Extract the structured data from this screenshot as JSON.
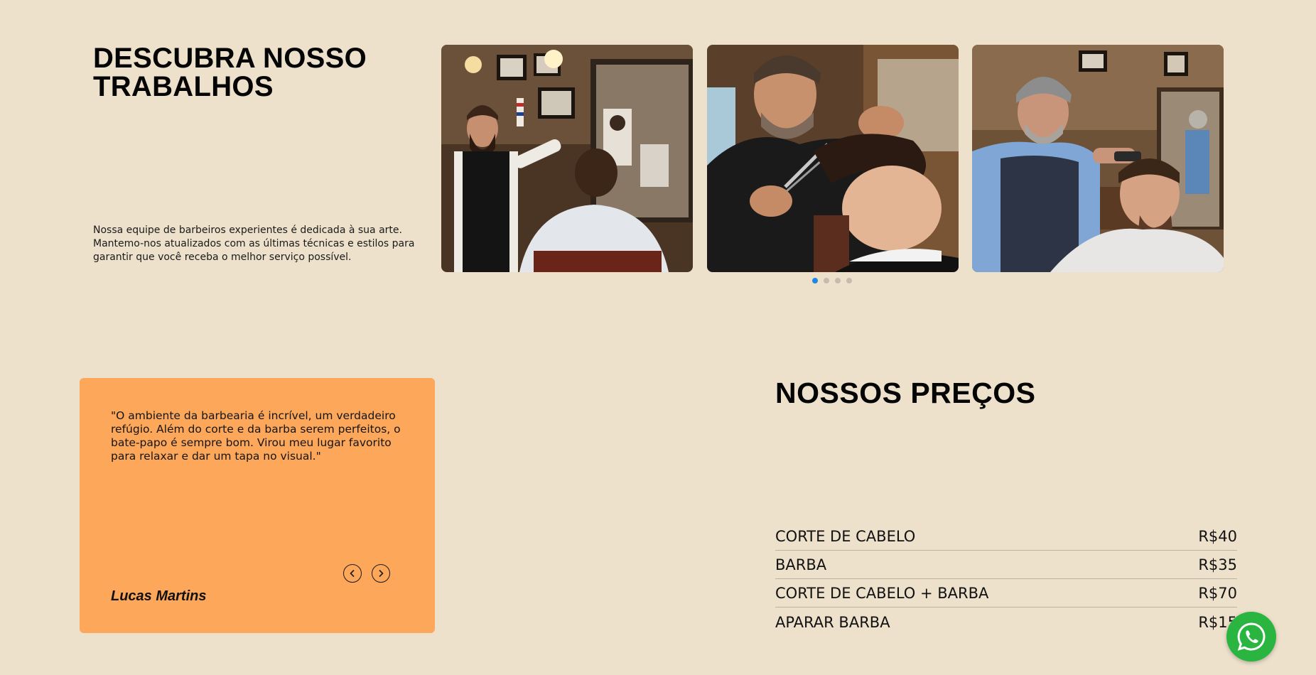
{
  "works": {
    "title": "DESCUBRA NOSSO TRABALHOS",
    "description": "Nossa equipe de barbeiros experientes é dedicada à sua arte. Mantemo-nos atualizados com as últimas técnicas e estilos para garantir que você receba o melhor serviço possível.",
    "carousel": {
      "slides": [
        {
          "icon": "barber-photo-1"
        },
        {
          "icon": "barber-photo-2"
        },
        {
          "icon": "barber-photo-3"
        }
      ],
      "dot_count": 4,
      "active_dot": 1,
      "active_color": "#1e88e5"
    }
  },
  "testimonial": {
    "quote": "\"O ambiente da barbearia é incrível, um verdadeiro refúgio. Além do corte e da barba serem perfeitos, o bate-papo é sempre bom. Virou meu lugar favorito para relaxar e dar um tapa no visual.\"",
    "author": "Lucas Martins",
    "prev_icon": "chevron-left-icon",
    "next_icon": "chevron-right-icon",
    "background": "#fca75a"
  },
  "prices": {
    "title": "NOSSOS PREÇOS",
    "items": [
      {
        "service": "CORTE DE CABELO",
        "price": "R$40"
      },
      {
        "service": "BARBA",
        "price": "R$35"
      },
      {
        "service": "CORTE DE CABELO + BARBA",
        "price": "R$70"
      },
      {
        "service": "APARAR BARBA",
        "price": "R$15"
      }
    ]
  },
  "whatsapp": {
    "icon": "whatsapp-icon",
    "color": "#2ab540"
  },
  "page": {
    "background": "#ede1cc"
  }
}
